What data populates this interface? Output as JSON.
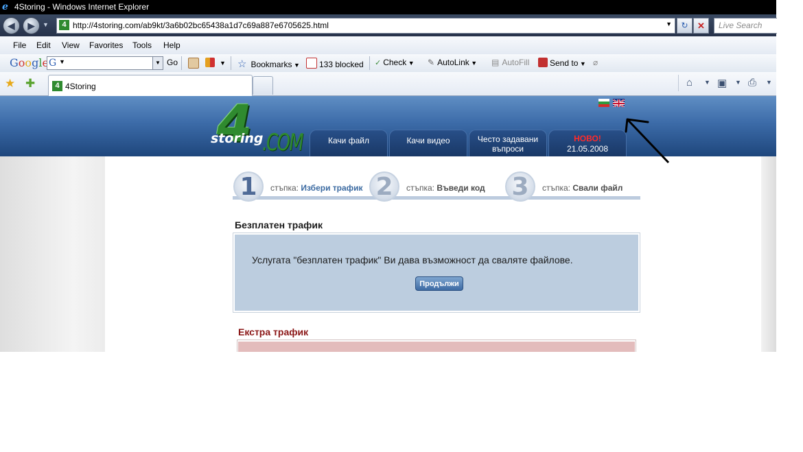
{
  "window": {
    "title": "4Storing - Windows Internet Explorer"
  },
  "address_bar": {
    "url": "http://4storing.com/ab9kt/3a6b02bc65438a1d7c69a887e6705625.html",
    "favicon": "4"
  },
  "search": {
    "placeholder": "Live Search"
  },
  "menu": {
    "items": [
      "File",
      "Edit",
      "View",
      "Favorites",
      "Tools",
      "Help"
    ]
  },
  "google_toolbar": {
    "logo": "Google",
    "go_label": "Go",
    "bookmarks_label": "Bookmarks",
    "blocked_label": "133 blocked",
    "check_label": "Check",
    "autolink_label": "AutoLink",
    "autofill_label": "AutoFill",
    "sendto_label": "Send to"
  },
  "tabs": {
    "active_title": "4Storing",
    "active_favicon": "4"
  },
  "site": {
    "logo": {
      "four": "4",
      "storing": "storing",
      "com": ".COM"
    },
    "nav": {
      "upload_file": "Качи файл",
      "upload_video": "Качи видео",
      "faq_line1": "Често задавани",
      "faq_line2": "въпроси",
      "new_label": "НОВО!",
      "new_date": "21.05.2008"
    },
    "steps": [
      {
        "number": "1",
        "prefix": "стъпка:",
        "label": "Избери трафик",
        "active": true
      },
      {
        "number": "2",
        "prefix": "стъпка:",
        "label": "Въведи код",
        "active": false
      },
      {
        "number": "3",
        "prefix": "стъпка:",
        "label": "Свали файл",
        "active": false
      }
    ],
    "free_traffic": {
      "title": "Безплатен трафик",
      "text": "Услугата \"безплатен трафик\" Ви дава възможност да сваляте файлове.",
      "button": "Продължи"
    },
    "extra_traffic": {
      "title": "Екстра трафик"
    }
  },
  "colors": {
    "header_blue": "#3c6ba8",
    "step_active": "#3b6aa1",
    "extra_title": "#8a1515",
    "new_red": "#ff2a2a"
  }
}
